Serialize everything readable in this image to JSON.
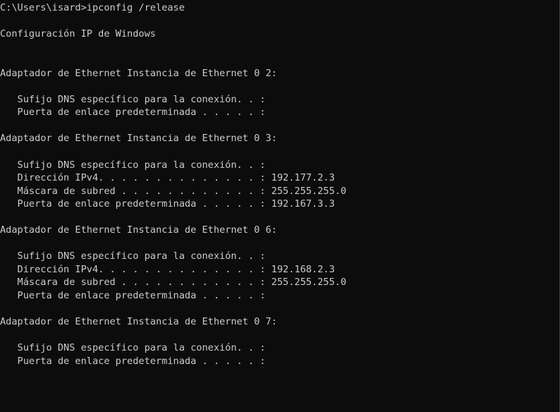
{
  "console": {
    "background": "#0c0c0c",
    "foreground": "#cccccc",
    "lines": [
      "C:\\Users\\isard>ipconfig /release",
      "",
      "Configuración IP de Windows",
      "",
      "",
      "Adaptador de Ethernet Instancia de Ethernet 0 2:",
      "",
      "   Sufijo DNS específico para la conexión. . :",
      "   Puerta de enlace predeterminada . . . . . :",
      "",
      "Adaptador de Ethernet Instancia de Ethernet 0 3:",
      "",
      "   Sufijo DNS específico para la conexión. . :",
      "   Dirección IPv4. . . . . . . . . . . . . . : 192.177.2.3",
      "   Máscara de subred . . . . . . . . . . . . : 255.255.255.0",
      "   Puerta de enlace predeterminada . . . . . : 192.167.3.3",
      "",
      "Adaptador de Ethernet Instancia de Ethernet 0 6:",
      "",
      "   Sufijo DNS específico para la conexión. . :",
      "   Dirección IPv4. . . . . . . . . . . . . . : 192.168.2.3",
      "   Máscara de subred . . . . . . . . . . . . : 255.255.255.0",
      "   Puerta de enlace predeterminada . . . . . :",
      "",
      "Adaptador de Ethernet Instancia de Ethernet 0 7:",
      "",
      "   Sufijo DNS específico para la conexión. . :",
      "   Puerta de enlace predeterminada . . . . . :"
    ]
  }
}
